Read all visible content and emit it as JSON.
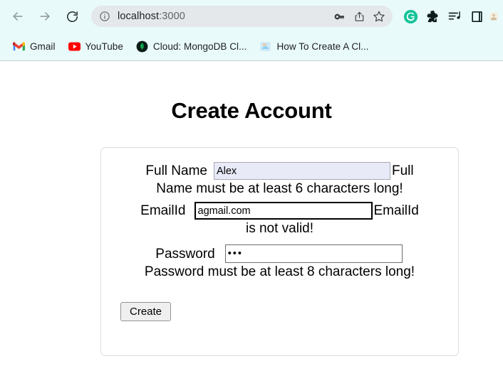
{
  "browser": {
    "nav": {
      "back": "back-arrow",
      "forward": "forward-arrow",
      "reload": "reload"
    },
    "omnibox": {
      "info_icon": "site-info-icon",
      "url_host": "localhost",
      "url_port": ":3000",
      "actions": [
        "password-key-icon",
        "share-icon",
        "bookmark-star-icon"
      ]
    },
    "extensions": [
      "grammarly-icon",
      "extensions-puzzle-icon",
      "media-playlist-icon",
      "reading-list-icon"
    ],
    "bookmarks": [
      {
        "label": "Gmail",
        "icon": "gmail-icon"
      },
      {
        "label": "YouTube",
        "icon": "youtube-icon"
      },
      {
        "label": "Cloud: MongoDB Cl...",
        "icon": "mongodb-icon"
      },
      {
        "label": "How To Create A Cl...",
        "icon": "generic-page-icon"
      }
    ]
  },
  "page": {
    "title": "Create Account",
    "fields": {
      "fullname": {
        "label": "Full Name",
        "value": "Alex",
        "trailing": "Full",
        "error": "Name must be at least 6 characters long!"
      },
      "email": {
        "label": "EmailId",
        "value": "agmail.com",
        "trailing": "EmailId",
        "error": "is not valid!"
      },
      "password": {
        "label": "Password",
        "value": "•••",
        "error": "Password must be at least 8 characters long!"
      }
    },
    "submit_label": "Create"
  },
  "colors": {
    "chrome_bg": "#e9fafa",
    "omnibox_bg": "#e4e8ea",
    "autofill_bg": "#e8eaf8",
    "card_border": "#dcdcdc",
    "grammarly_green": "#15c39a",
    "youtube_red": "#ff0000",
    "mongodb_green": "#13aa52"
  }
}
